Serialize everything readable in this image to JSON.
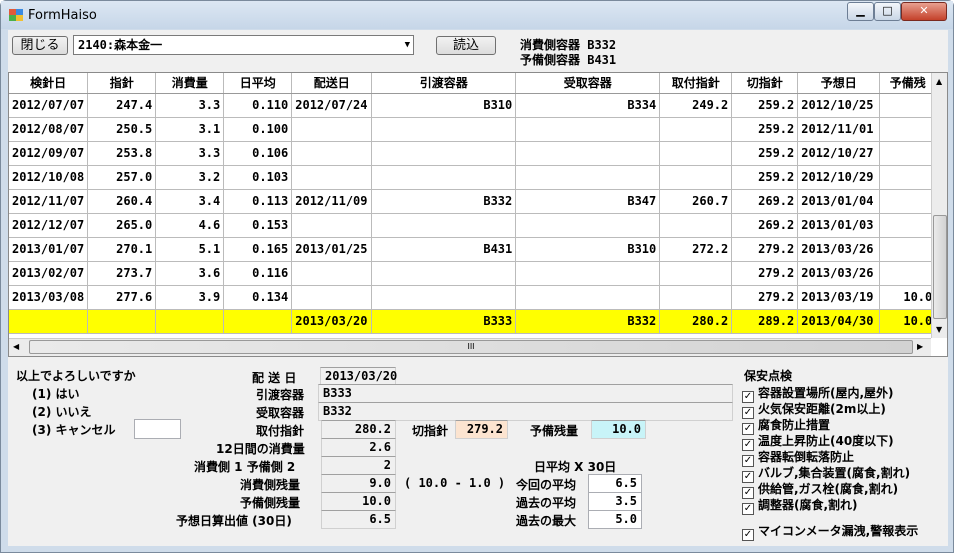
{
  "window": {
    "title": "FormHaiso",
    "min": "▁",
    "max": "□",
    "close": "✕"
  },
  "toolbar": {
    "close_btn": "閉じる",
    "customer": "2140:森本金一",
    "read_btn": "読込",
    "consume_container": "消費側容器 B332",
    "reserve_container": "予備側容器 B431"
  },
  "table": {
    "headers": [
      "検針日",
      "指針",
      "消費量",
      "日平均",
      "配送日",
      "引渡容器",
      "受取容器",
      "取付指針",
      "切指針",
      "予想日",
      "予備残"
    ],
    "rows": [
      [
        "2012/07/07",
        "247.4",
        "3.3",
        "0.110",
        "2012/07/24",
        "B310",
        "B334",
        "249.2",
        "259.2",
        "2012/10/25",
        ""
      ],
      [
        "2012/08/07",
        "250.5",
        "3.1",
        "0.100",
        "",
        "",
        "",
        "",
        "259.2",
        "2012/11/01",
        ""
      ],
      [
        "2012/09/07",
        "253.8",
        "3.3",
        "0.106",
        "",
        "",
        "",
        "",
        "259.2",
        "2012/10/27",
        ""
      ],
      [
        "2012/10/08",
        "257.0",
        "3.2",
        "0.103",
        "",
        "",
        "",
        "",
        "259.2",
        "2012/10/29",
        ""
      ],
      [
        "2012/11/07",
        "260.4",
        "3.4",
        "0.113",
        "2012/11/09",
        "B332",
        "B347",
        "260.7",
        "269.2",
        "2013/01/04",
        ""
      ],
      [
        "2012/12/07",
        "265.0",
        "4.6",
        "0.153",
        "",
        "",
        "",
        "",
        "269.2",
        "2013/01/03",
        ""
      ],
      [
        "2013/01/07",
        "270.1",
        "5.1",
        "0.165",
        "2013/01/25",
        "B431",
        "B310",
        "272.2",
        "279.2",
        "2013/03/26",
        ""
      ],
      [
        "2013/02/07",
        "273.7",
        "3.6",
        "0.116",
        "",
        "",
        "",
        "",
        "279.2",
        "2013/03/26",
        ""
      ],
      [
        "2013/03/08",
        "277.6",
        "3.9",
        "0.134",
        "",
        "",
        "",
        "",
        "279.2",
        "2013/03/19",
        "10.0"
      ],
      [
        "",
        "",
        "",
        "",
        "2013/03/20",
        "B333",
        "B332",
        "280.2",
        "289.2",
        "2013/04/30",
        "10.0"
      ]
    ],
    "highlight_color": "#ffff00",
    "hscroll_mark": "III"
  },
  "confirm": {
    "question": "以上でよろしいですか",
    "opt1": "(1) はい",
    "opt2": "(2) いいえ",
    "opt3": "(3) キャンセル",
    "input": ""
  },
  "detail": {
    "delivery_date_label": "配 送 日",
    "delivery_date": "2013/03/20",
    "hand_label": "引渡容器",
    "hand": "B333",
    "recv_label": "受取容器",
    "recv": "B332",
    "attach_label": "取付指針",
    "attach": "280.2",
    "cut_label": "切指針",
    "cut": "279.2",
    "reserve_label": "予備残量",
    "reserve": "10.0",
    "usage12_label": "12日間の消費量",
    "usage12": "2.6",
    "ratio_label": "消費側 1 予備側 2",
    "ratio": "2",
    "consume_remain_label": "消費側残量",
    "consume_remain": "9.0",
    "formula": "( 10.0 - 1.0 )",
    "reserve_remain_label": "予備側残量",
    "reserve_remain": "10.0",
    "predict_label": "予想日算出値 (30日)",
    "predict": "6.5",
    "avg_header": "日平均 X 30日",
    "avg_now_label": "今回の平均",
    "avg_now": "6.5",
    "avg_past_label": "過去の平均",
    "avg_past": "3.5",
    "max_past_label": "過去の最大",
    "max_past": "5.0",
    "colors": {
      "cut": "#fce4d0",
      "reserve": "#c8f4f8"
    }
  },
  "safety": {
    "title": "保安点検",
    "items": [
      "容器設置場所(屋内,屋外)",
      "火気保安距離(2m以上)",
      "腐食防止措置",
      "温度上昇防止(40度以下)",
      "容器転倒転落防止",
      "バルブ,集合装置(腐食,割れ)",
      "供給管,ガス栓(腐食,割れ)",
      "調整器(腐食,割れ)"
    ],
    "meter": "マイコンメータ漏洩,警報表示",
    "check": "✓"
  }
}
